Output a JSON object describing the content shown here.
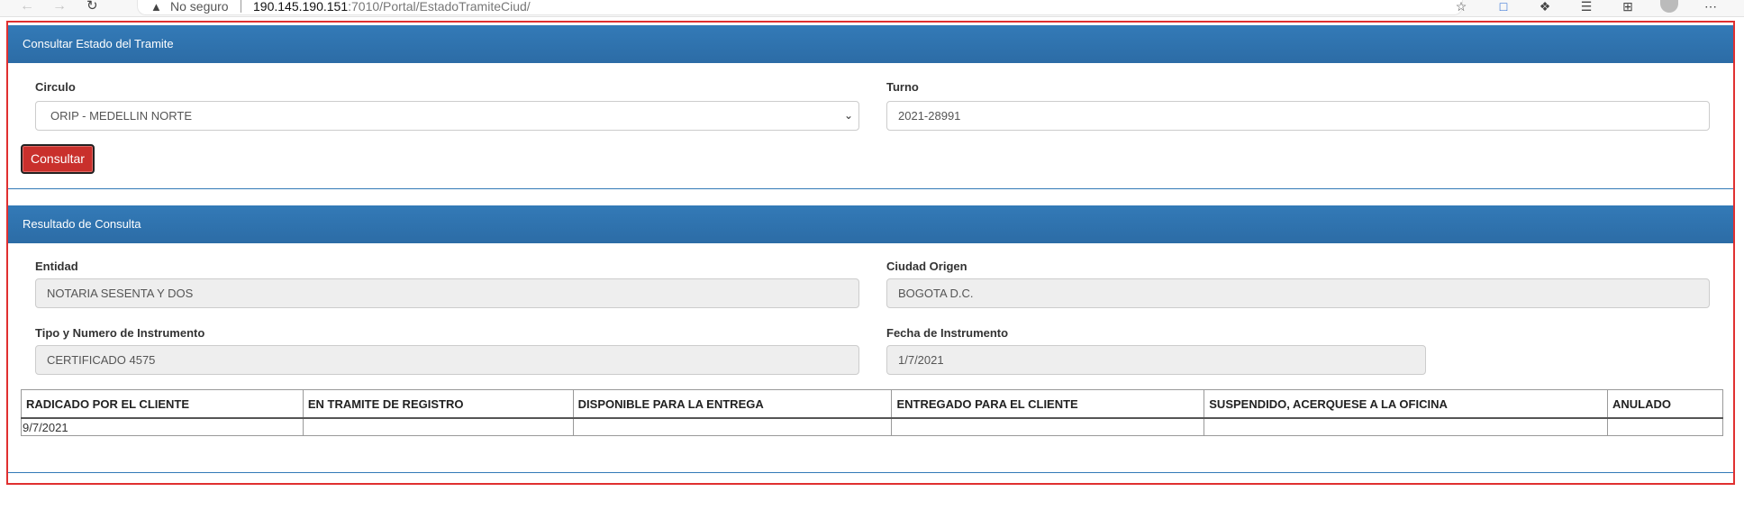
{
  "browser": {
    "not_secure_label": "No seguro",
    "url_host": "190.145.190.151",
    "url_path": ":7010/Portal/EstadoTramiteCiud/"
  },
  "consulta": {
    "title": "Consultar Estado del Tramite",
    "circulo_label": "Circulo",
    "circulo_value": "ORIP - MEDELLIN NORTE",
    "turno_label": "Turno",
    "turno_value": "2021-28991",
    "button_label": "Consultar"
  },
  "resultado": {
    "title": "Resultado de Consulta",
    "entidad_label": "Entidad",
    "entidad_value": "NOTARIA SESENTA Y DOS",
    "ciudad_label": "Ciudad Origen",
    "ciudad_value": "BOGOTA D.C.",
    "tipo_label": "Tipo y Numero de Instrumento",
    "tipo_value": "CERTIFICADO 4575",
    "fecha_label": "Fecha de Instrumento",
    "fecha_value": "1/7/2021",
    "table": {
      "headers": [
        "RADICADO POR EL CLIENTE",
        "EN TRAMITE DE REGISTRO",
        "DISPONIBLE PARA LA ENTREGA",
        "ENTREGADO PARA EL CLIENTE",
        "SUSPENDIDO, ACERQUESE A LA OFICINA",
        "ANULADO"
      ],
      "row": [
        "9/7/2021",
        "",
        "",
        "",
        "",
        ""
      ]
    }
  }
}
